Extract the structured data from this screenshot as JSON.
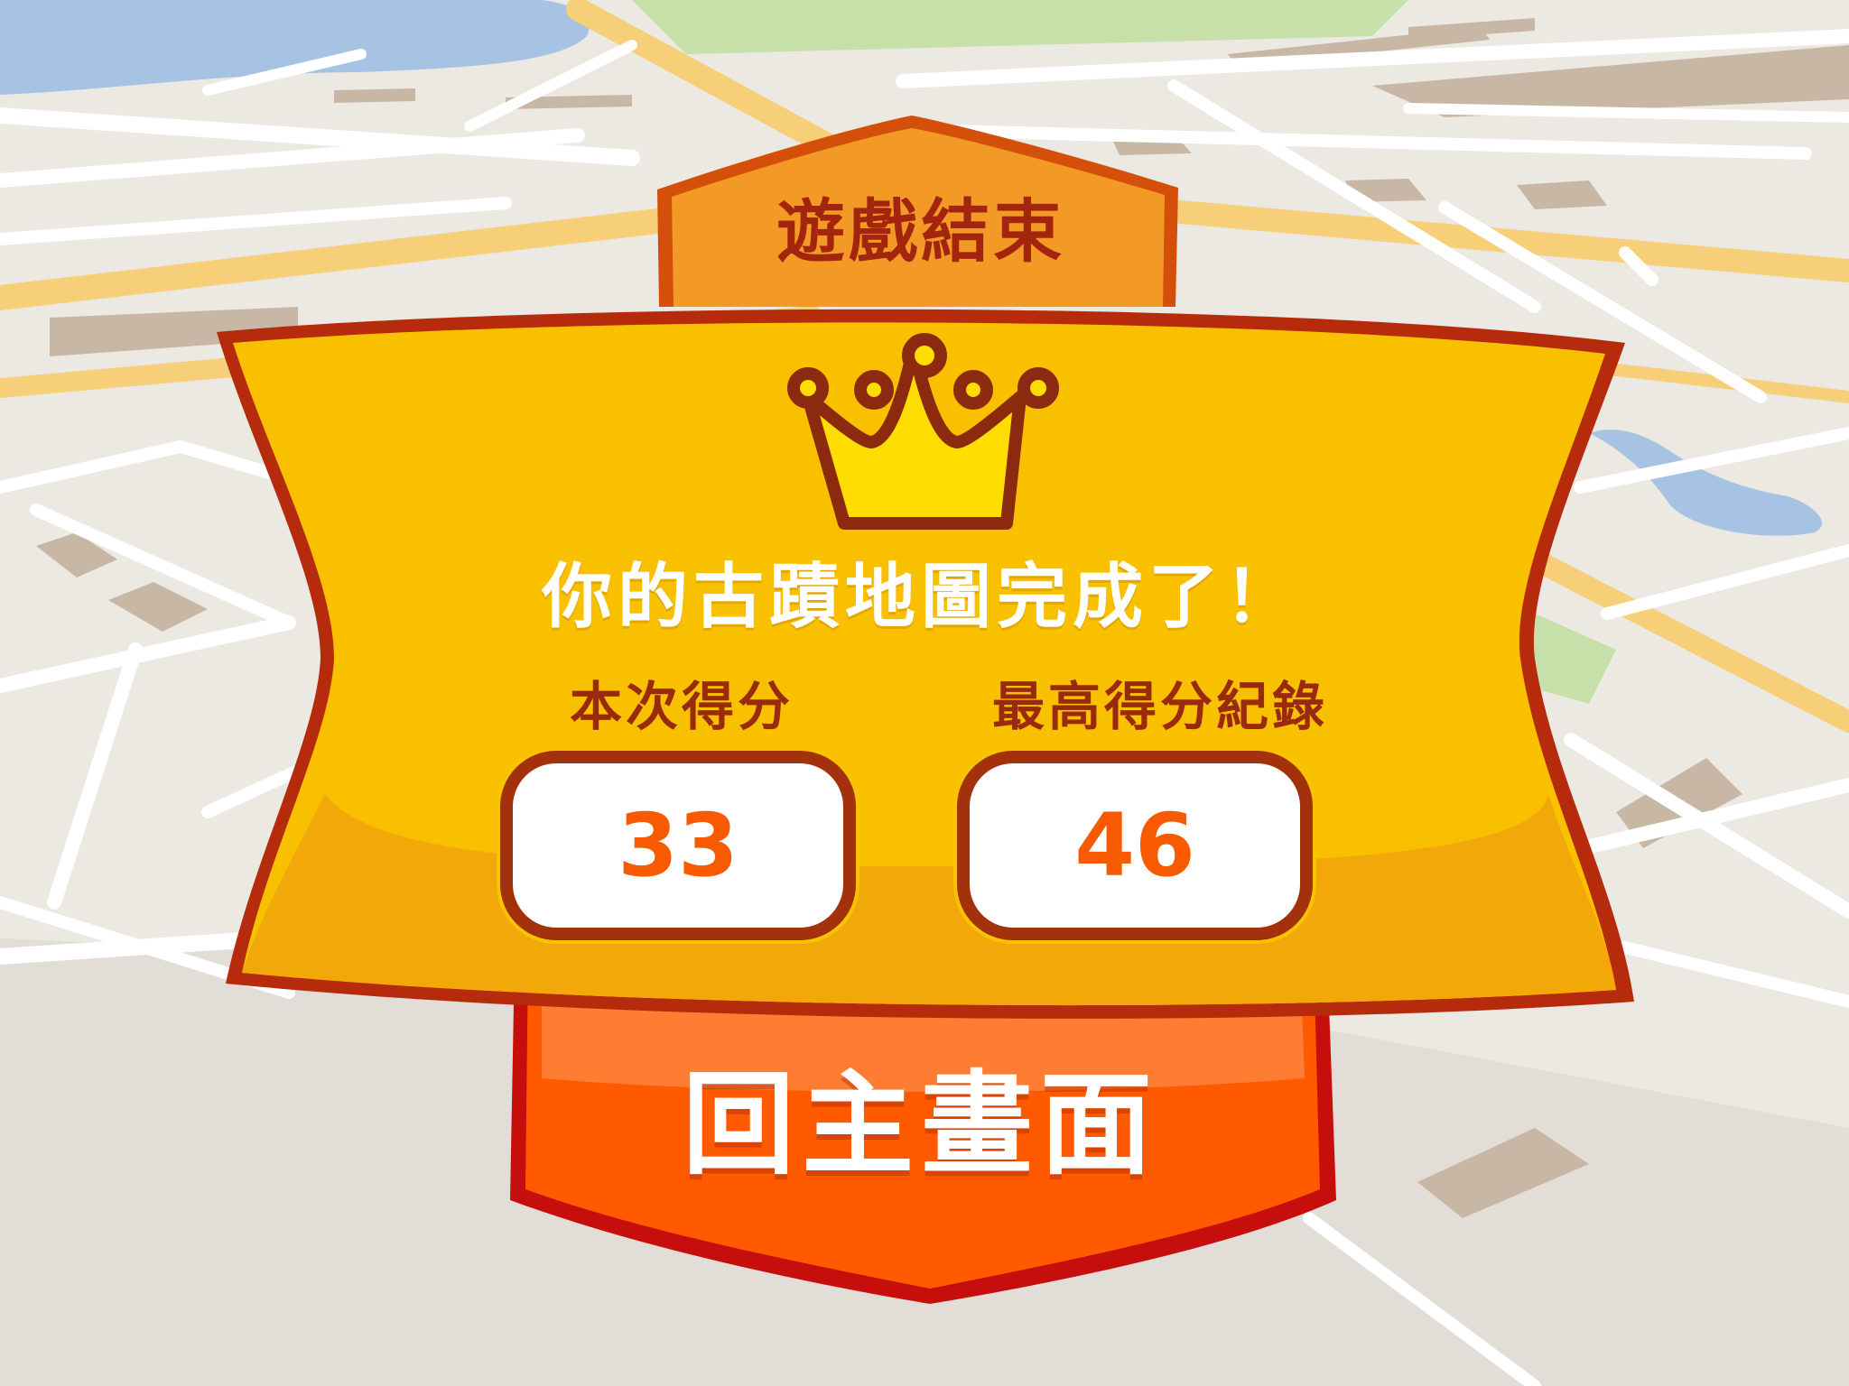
{
  "title": "遊戲結束",
  "icon": "crown-icon",
  "message": "你的古蹟地圖完成了！",
  "scores": {
    "current_label": "本次得分",
    "current_value": "33",
    "best_label": "最高得分紀錄",
    "best_value": "46"
  },
  "home_button": {
    "label": "回主畫面"
  },
  "colors": {
    "panel": "#f9c000",
    "panel_outline": "#b52b0c",
    "title_ribbon": "#f39a26",
    "button": "#ff5a00",
    "score_text": "#f75a00"
  }
}
